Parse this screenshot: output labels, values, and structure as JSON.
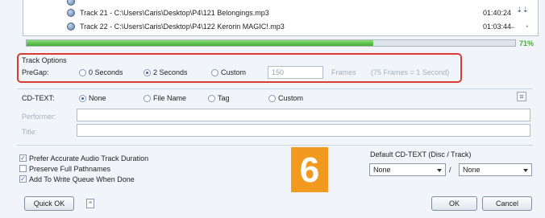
{
  "tracks": [
    {
      "label": "Track 21 - C:\\Users\\Caris\\Desktop\\P4\\121 Belongings.mp3",
      "duration": "01:40:24"
    },
    {
      "label": "Track 22 - C:\\Users\\Caris\\Desktop\\P4\\122 Kerorin MAGIC!.mp3",
      "duration": "01:03:44"
    }
  ],
  "progress": {
    "value": 71,
    "label": "71%",
    "color": "#3fae2e"
  },
  "track_options": {
    "title": "Track Options",
    "pregap_label": "PreGap:",
    "options": [
      "0 Seconds",
      "2 Seconds",
      "Custom"
    ],
    "selected": "2 Seconds",
    "custom_value": "150",
    "frames_label": "Frames",
    "frames_hint": "(75 Frames = 1 Second)",
    "highlight_color": "#d83c32"
  },
  "cd_text": {
    "label": "CD-TEXT:",
    "options": [
      "None",
      "File Name",
      "Tag",
      "Custom"
    ],
    "selected": "None",
    "performer_label": "Performer:",
    "title_label": "Title:"
  },
  "checkboxes": [
    {
      "label": "Prefer Accurate Audio Track Duration",
      "checked": true
    },
    {
      "label": "Preserve Full Pathnames",
      "checked": false
    },
    {
      "label": "Add To Write Queue When Done",
      "checked": true
    }
  ],
  "default_cd_text": {
    "label": "Default CD-TEXT (Disc / Track)",
    "disc_value": "None",
    "separator": "/",
    "track_value": "None"
  },
  "buttons": {
    "quick_ok": "Quick OK",
    "ok": "OK",
    "cancel": "Cancel"
  },
  "badge": {
    "text": "6",
    "color": "#f29a1f"
  }
}
